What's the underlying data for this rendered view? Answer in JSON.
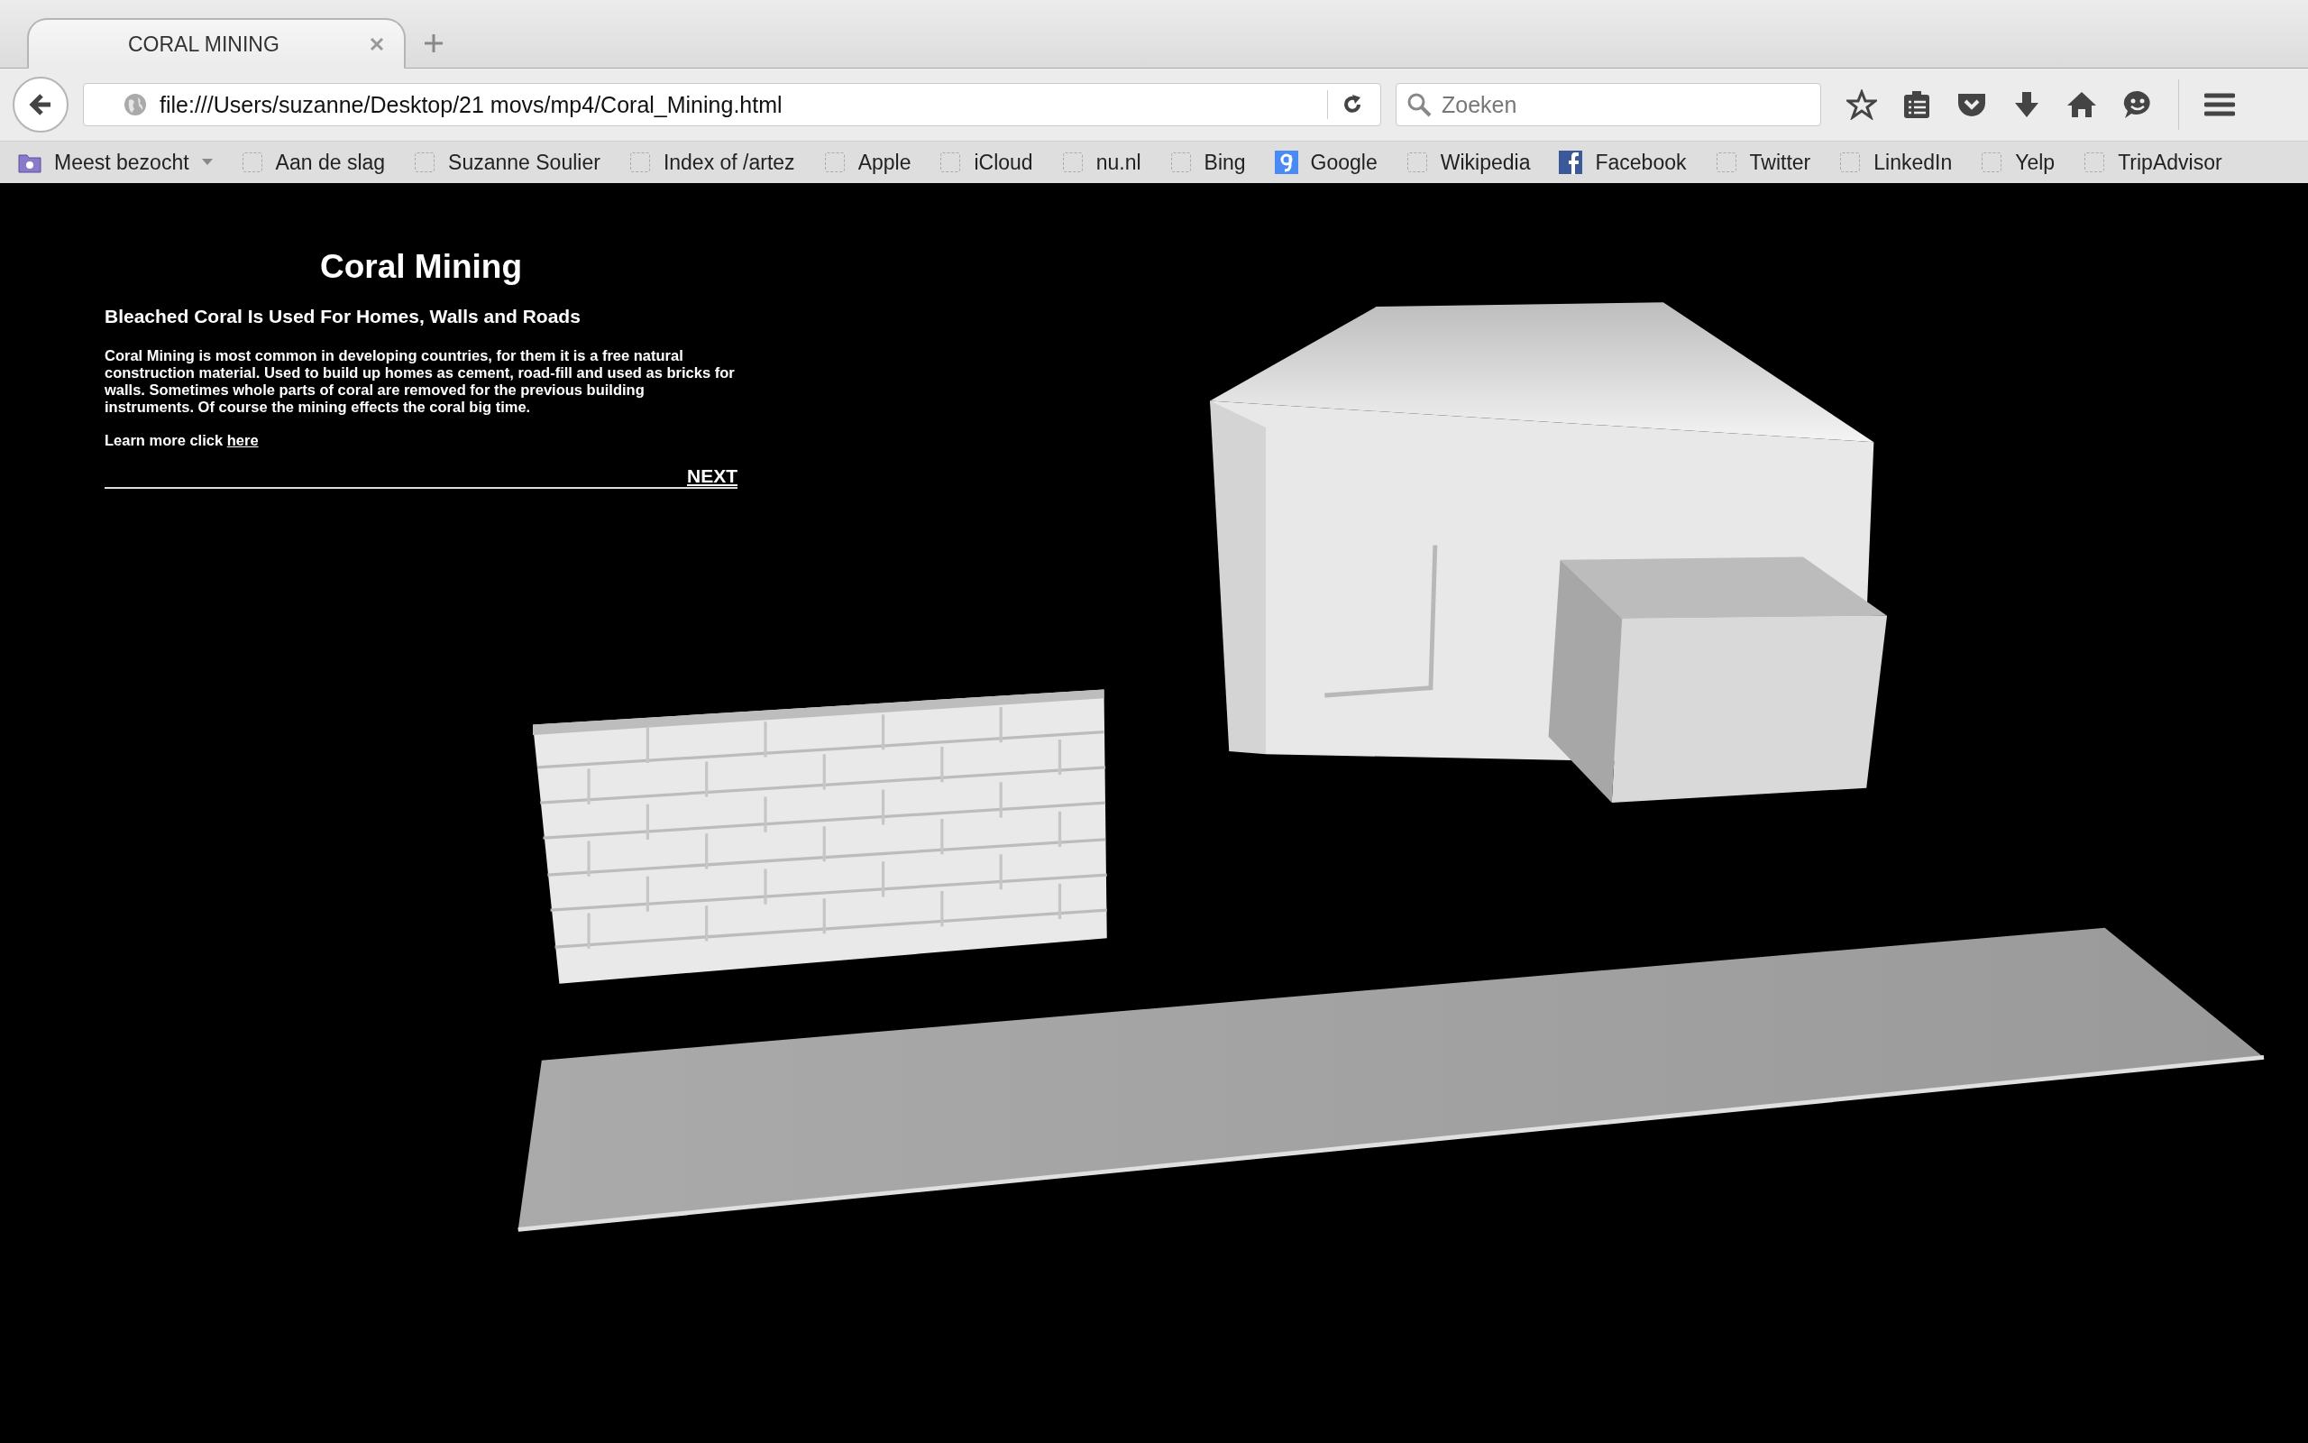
{
  "tabs": [
    {
      "title": "CORAL MINING",
      "selected": true
    }
  ],
  "toolbar": {
    "url": "file:///Users/suzanne/Desktop/21 movs/mp4/Coral_Mining.html",
    "search_placeholder": "Zoeken"
  },
  "bookmarks": [
    {
      "label": "Meest bezocht",
      "kind": "folder"
    },
    {
      "label": "Aan de slag",
      "kind": "page"
    },
    {
      "label": "Suzanne Soulier",
      "kind": "page"
    },
    {
      "label": "Index of /artez",
      "kind": "page"
    },
    {
      "label": "Apple",
      "kind": "page"
    },
    {
      "label": "iCloud",
      "kind": "page"
    },
    {
      "label": "nu.nl",
      "kind": "page"
    },
    {
      "label": "Bing",
      "kind": "page"
    },
    {
      "label": "Google",
      "kind": "google"
    },
    {
      "label": "Wikipedia",
      "kind": "page"
    },
    {
      "label": "Facebook",
      "kind": "facebook"
    },
    {
      "label": "Twitter",
      "kind": "page"
    },
    {
      "label": "LinkedIn",
      "kind": "page"
    },
    {
      "label": "Yelp",
      "kind": "page"
    },
    {
      "label": "TripAdvisor",
      "kind": "page"
    }
  ],
  "page": {
    "title": "Coral Mining",
    "subtitle": "Bleached Coral Is Used For Homes, Walls and Roads",
    "body": "Coral Mining is most common in developing countries, for them it is a free natural construction material. Used to build up homes as cement, road-fill and used as bricks for walls. Sometimes whole parts of coral are removed for the previous building instruments. Of course the mining effects the coral big time.",
    "learn_more": "Learn more click",
    "learn_more_link": "here",
    "next": "NEXT"
  }
}
